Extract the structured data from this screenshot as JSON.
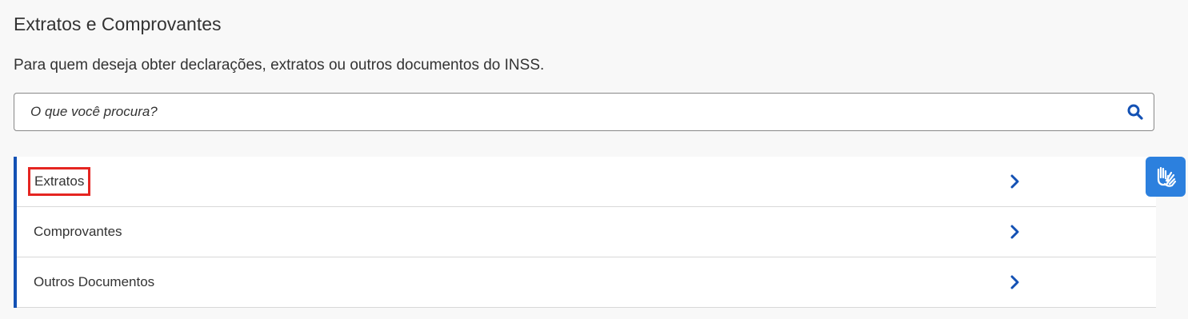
{
  "header": {
    "title": "Extratos e Comprovantes",
    "description": "Para quem deseja obter declarações, extratos ou outros documentos do INSS."
  },
  "search": {
    "placeholder": "O que você procura?",
    "value": "",
    "icon": "search-icon"
  },
  "menu": {
    "items": [
      {
        "label": "Extratos",
        "icon": "chevron-right-icon",
        "highlighted": true
      },
      {
        "label": "Comprovantes",
        "icon": "chevron-right-icon",
        "highlighted": false
      },
      {
        "label": "Outros Documentos",
        "icon": "chevron-right-icon",
        "highlighted": false
      }
    ]
  },
  "accessibility": {
    "icon": "sign-language-hands-icon"
  },
  "colors": {
    "accent": "#1351b4",
    "highlight": "#e52521",
    "widget": "#2c80de",
    "background": "#f8f8f8"
  }
}
